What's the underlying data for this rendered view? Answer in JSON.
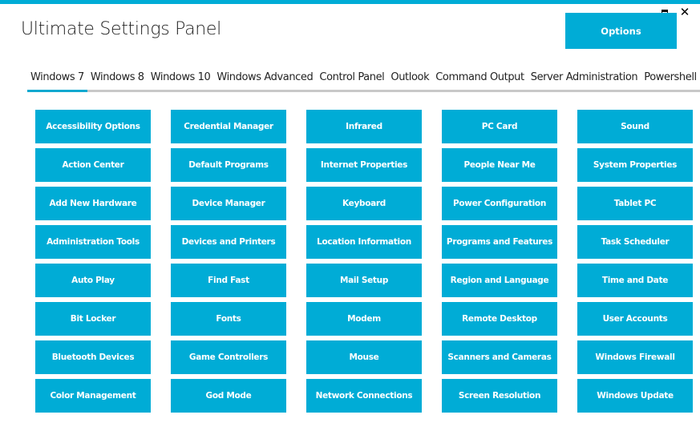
{
  "window": {
    "title": "Ultimate Settings Panel",
    "maximize_icon": "maximize-icon",
    "close_icon": "close-icon",
    "close_glyph": "✕"
  },
  "header": {
    "options_label": "Options"
  },
  "colors": {
    "accent": "#00acd6",
    "tab_underline": "#c8c8c8"
  },
  "tabs": [
    {
      "label": "Windows 7",
      "active": true
    },
    {
      "label": "Windows 8",
      "active": false
    },
    {
      "label": "Windows 10",
      "active": false
    },
    {
      "label": "Windows Advanced",
      "active": false
    },
    {
      "label": "Control Panel",
      "active": false
    },
    {
      "label": "Outlook",
      "active": false
    },
    {
      "label": "Command Output",
      "active": false
    },
    {
      "label": "Server Administration",
      "active": false
    },
    {
      "label": "Powershell",
      "active": false
    }
  ],
  "tiles": [
    "Accessibility Options",
    "Action Center",
    "Add New Hardware",
    "Administration Tools",
    "Auto Play",
    "Bit Locker",
    "Bluetooth Devices",
    "Color Management",
    "Credential Manager",
    "Default Programs",
    "Device Manager",
    "Devices and Printers",
    "Find Fast",
    "Fonts",
    "Game Controllers",
    "God Mode",
    "Infrared",
    "Internet Properties",
    "Keyboard",
    "Location Information",
    "Mail Setup",
    "Modem",
    "Mouse",
    "Network Connections",
    "PC Card",
    "People Near Me",
    "Power Configuration",
    "Programs and Features",
    "Region and Language",
    "Remote Desktop",
    "Scanners and Cameras",
    "Screen Resolution",
    "Sound",
    "System Properties",
    "Tablet PC",
    "Task Scheduler",
    "Time and Date",
    "User Accounts",
    "Windows Firewall",
    "Windows Update"
  ]
}
